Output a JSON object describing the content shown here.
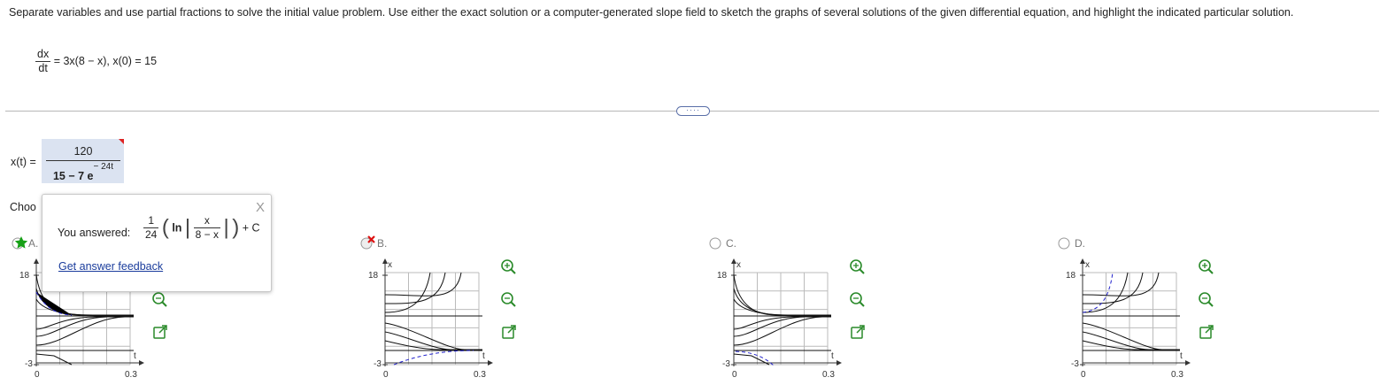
{
  "question": {
    "text": "Separate variables and use partial fractions to solve the initial value problem. Use either the exact solution or a computer-generated slope field to sketch the graphs of several solutions of the given differential equation, and highlight the indicated particular solution.",
    "de_numerator": "dx",
    "de_denominator": "dt",
    "de_rhs": "= 3x(8 − x), x(0) = 15"
  },
  "more_button": "····",
  "answer": {
    "label": "x(t) =",
    "numerator": "120",
    "denominator_base": "15 − 7 e",
    "denominator_exp": "− 24t"
  },
  "choose_label": "Choo",
  "popup": {
    "close": "X",
    "you_answered": "You answered:",
    "frac_num": "1",
    "frac_den": "24",
    "ln": "ln",
    "inner_num": "x",
    "inner_den": "8 − x",
    "plus_c": "+ C",
    "feedback_link": "Get answer feedback"
  },
  "options": [
    {
      "letter": "A.",
      "state": "correct"
    },
    {
      "letter": "B.",
      "state": "wrong"
    },
    {
      "letter": "C.",
      "state": "none"
    },
    {
      "letter": "D.",
      "state": "none"
    }
  ],
  "graph_labels": {
    "y_top": "18",
    "y_bottom": "-3",
    "x_left": "0",
    "x_right": "0.3",
    "x_axis": "t",
    "y_axis": "x"
  },
  "icons": {
    "zoom_in": "zoom-in-icon",
    "zoom_out": "zoom-out-icon",
    "popout": "popout-icon"
  },
  "colors": {
    "highlight": "#2222cc",
    "answer_bg": "#dbe3f1",
    "correct_star": "#16a016",
    "wrong_x": "#dd1111"
  }
}
